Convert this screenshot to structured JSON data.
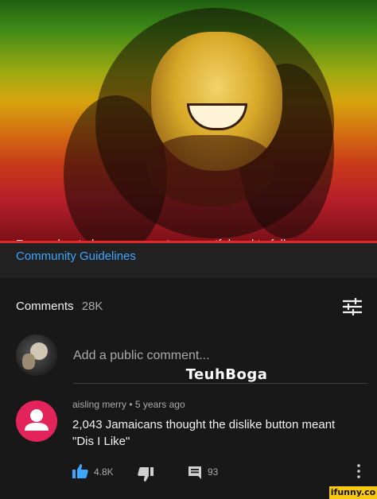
{
  "notice": {
    "cut_text": "Remember to keep comments respectful and to follow our",
    "link_text": "Community Guidelines"
  },
  "comments": {
    "label": "Comments",
    "count": "28K",
    "add_placeholder": "Add a public comment..."
  },
  "overlay_username": "TeuhBoga",
  "comment": {
    "author": "aisling merry",
    "separator": "•",
    "age": "5 years ago",
    "text": "2,043 Jamaicans thought the dislike button meant \"Dis I Like\"",
    "likes": "4.8K",
    "replies": "93"
  },
  "watermark": "ifunny.co",
  "colors": {
    "link": "#3ea6ff",
    "like_active": "#3ea6ff",
    "user_avatar": "#e3245a",
    "background": "#181818",
    "accent_line": "#e4272a",
    "watermark_bg": "#f7c90b"
  },
  "icons": {
    "sort": "sort-sliders-icon",
    "like": "thumbs-up-filled-icon",
    "dislike": "thumbs-down-icon",
    "reply": "comment-reply-icon",
    "more": "more-vertical-icon"
  }
}
